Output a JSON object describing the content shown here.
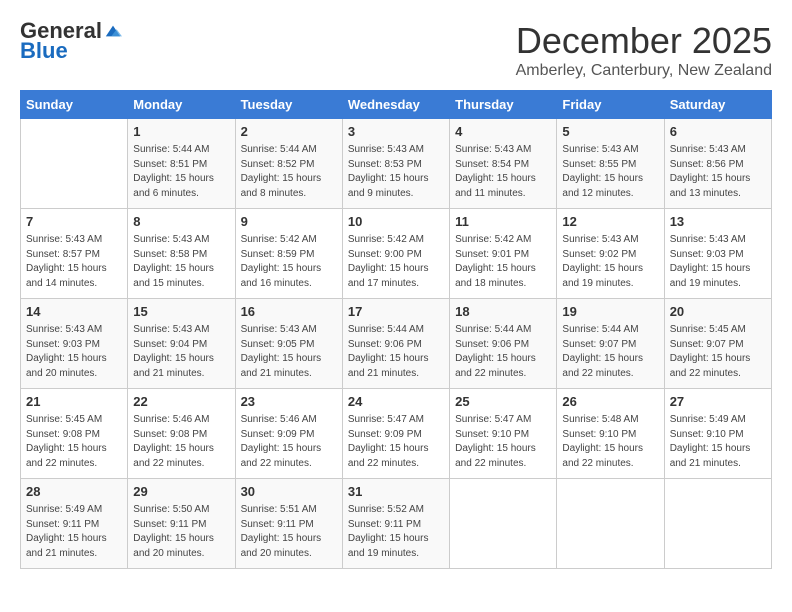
{
  "header": {
    "logo_general": "General",
    "logo_blue": "Blue",
    "month_title": "December 2025",
    "subtitle": "Amberley, Canterbury, New Zealand"
  },
  "days_of_week": [
    "Sunday",
    "Monday",
    "Tuesday",
    "Wednesday",
    "Thursday",
    "Friday",
    "Saturday"
  ],
  "weeks": [
    [
      {
        "day": "",
        "info": ""
      },
      {
        "day": "1",
        "info": "Sunrise: 5:44 AM\nSunset: 8:51 PM\nDaylight: 15 hours\nand 6 minutes."
      },
      {
        "day": "2",
        "info": "Sunrise: 5:44 AM\nSunset: 8:52 PM\nDaylight: 15 hours\nand 8 minutes."
      },
      {
        "day": "3",
        "info": "Sunrise: 5:43 AM\nSunset: 8:53 PM\nDaylight: 15 hours\nand 9 minutes."
      },
      {
        "day": "4",
        "info": "Sunrise: 5:43 AM\nSunset: 8:54 PM\nDaylight: 15 hours\nand 11 minutes."
      },
      {
        "day": "5",
        "info": "Sunrise: 5:43 AM\nSunset: 8:55 PM\nDaylight: 15 hours\nand 12 minutes."
      },
      {
        "day": "6",
        "info": "Sunrise: 5:43 AM\nSunset: 8:56 PM\nDaylight: 15 hours\nand 13 minutes."
      }
    ],
    [
      {
        "day": "7",
        "info": "Sunrise: 5:43 AM\nSunset: 8:57 PM\nDaylight: 15 hours\nand 14 minutes."
      },
      {
        "day": "8",
        "info": "Sunrise: 5:43 AM\nSunset: 8:58 PM\nDaylight: 15 hours\nand 15 minutes."
      },
      {
        "day": "9",
        "info": "Sunrise: 5:42 AM\nSunset: 8:59 PM\nDaylight: 15 hours\nand 16 minutes."
      },
      {
        "day": "10",
        "info": "Sunrise: 5:42 AM\nSunset: 9:00 PM\nDaylight: 15 hours\nand 17 minutes."
      },
      {
        "day": "11",
        "info": "Sunrise: 5:42 AM\nSunset: 9:01 PM\nDaylight: 15 hours\nand 18 minutes."
      },
      {
        "day": "12",
        "info": "Sunrise: 5:43 AM\nSunset: 9:02 PM\nDaylight: 15 hours\nand 19 minutes."
      },
      {
        "day": "13",
        "info": "Sunrise: 5:43 AM\nSunset: 9:03 PM\nDaylight: 15 hours\nand 19 minutes."
      }
    ],
    [
      {
        "day": "14",
        "info": "Sunrise: 5:43 AM\nSunset: 9:03 PM\nDaylight: 15 hours\nand 20 minutes."
      },
      {
        "day": "15",
        "info": "Sunrise: 5:43 AM\nSunset: 9:04 PM\nDaylight: 15 hours\nand 21 minutes."
      },
      {
        "day": "16",
        "info": "Sunrise: 5:43 AM\nSunset: 9:05 PM\nDaylight: 15 hours\nand 21 minutes."
      },
      {
        "day": "17",
        "info": "Sunrise: 5:44 AM\nSunset: 9:06 PM\nDaylight: 15 hours\nand 21 minutes."
      },
      {
        "day": "18",
        "info": "Sunrise: 5:44 AM\nSunset: 9:06 PM\nDaylight: 15 hours\nand 22 minutes."
      },
      {
        "day": "19",
        "info": "Sunrise: 5:44 AM\nSunset: 9:07 PM\nDaylight: 15 hours\nand 22 minutes."
      },
      {
        "day": "20",
        "info": "Sunrise: 5:45 AM\nSunset: 9:07 PM\nDaylight: 15 hours\nand 22 minutes."
      }
    ],
    [
      {
        "day": "21",
        "info": "Sunrise: 5:45 AM\nSunset: 9:08 PM\nDaylight: 15 hours\nand 22 minutes."
      },
      {
        "day": "22",
        "info": "Sunrise: 5:46 AM\nSunset: 9:08 PM\nDaylight: 15 hours\nand 22 minutes."
      },
      {
        "day": "23",
        "info": "Sunrise: 5:46 AM\nSunset: 9:09 PM\nDaylight: 15 hours\nand 22 minutes."
      },
      {
        "day": "24",
        "info": "Sunrise: 5:47 AM\nSunset: 9:09 PM\nDaylight: 15 hours\nand 22 minutes."
      },
      {
        "day": "25",
        "info": "Sunrise: 5:47 AM\nSunset: 9:10 PM\nDaylight: 15 hours\nand 22 minutes."
      },
      {
        "day": "26",
        "info": "Sunrise: 5:48 AM\nSunset: 9:10 PM\nDaylight: 15 hours\nand 22 minutes."
      },
      {
        "day": "27",
        "info": "Sunrise: 5:49 AM\nSunset: 9:10 PM\nDaylight: 15 hours\nand 21 minutes."
      }
    ],
    [
      {
        "day": "28",
        "info": "Sunrise: 5:49 AM\nSunset: 9:11 PM\nDaylight: 15 hours\nand 21 minutes."
      },
      {
        "day": "29",
        "info": "Sunrise: 5:50 AM\nSunset: 9:11 PM\nDaylight: 15 hours\nand 20 minutes."
      },
      {
        "day": "30",
        "info": "Sunrise: 5:51 AM\nSunset: 9:11 PM\nDaylight: 15 hours\nand 20 minutes."
      },
      {
        "day": "31",
        "info": "Sunrise: 5:52 AM\nSunset: 9:11 PM\nDaylight: 15 hours\nand 19 minutes."
      },
      {
        "day": "",
        "info": ""
      },
      {
        "day": "",
        "info": ""
      },
      {
        "day": "",
        "info": ""
      }
    ]
  ]
}
